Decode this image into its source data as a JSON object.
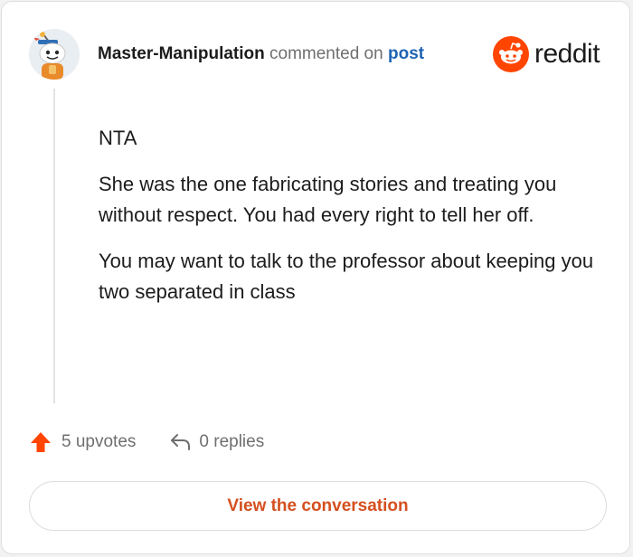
{
  "comment": {
    "username": "Master-Manipulation",
    "action_text": "commented on",
    "link_text": "post",
    "paragraphs": [
      "NTA",
      "She was the one fabricating stories and treating you without respect. You had every right to tell her off.",
      "You may want to talk to the professor about keeping you two separated in class"
    ]
  },
  "brand": {
    "name": "reddit",
    "icon": "reddit-snoo-icon",
    "color": "#ff4500"
  },
  "stats": {
    "upvotes_label": "5 upvotes",
    "upvote_icon": "upvote-arrow-icon",
    "replies_label": "0 replies",
    "reply_icon": "reply-arrow-icon"
  },
  "cta": {
    "label": "View the conversation",
    "color": "#d4501f"
  }
}
